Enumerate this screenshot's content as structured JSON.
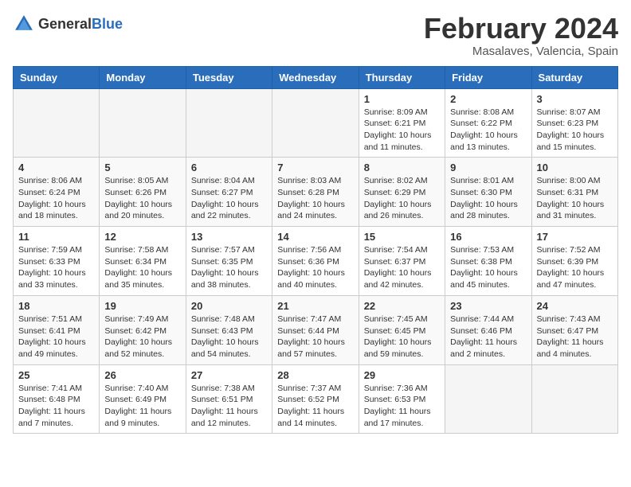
{
  "header": {
    "logo_general": "General",
    "logo_blue": "Blue",
    "month_year": "February 2024",
    "location": "Masalaves, Valencia, Spain"
  },
  "days_of_week": [
    "Sunday",
    "Monday",
    "Tuesday",
    "Wednesday",
    "Thursday",
    "Friday",
    "Saturday"
  ],
  "weeks": [
    [
      {
        "day": "",
        "info": ""
      },
      {
        "day": "",
        "info": ""
      },
      {
        "day": "",
        "info": ""
      },
      {
        "day": "",
        "info": ""
      },
      {
        "day": "1",
        "info": "Sunrise: 8:09 AM\nSunset: 6:21 PM\nDaylight: 10 hours and 11 minutes."
      },
      {
        "day": "2",
        "info": "Sunrise: 8:08 AM\nSunset: 6:22 PM\nDaylight: 10 hours and 13 minutes."
      },
      {
        "day": "3",
        "info": "Sunrise: 8:07 AM\nSunset: 6:23 PM\nDaylight: 10 hours and 15 minutes."
      }
    ],
    [
      {
        "day": "4",
        "info": "Sunrise: 8:06 AM\nSunset: 6:24 PM\nDaylight: 10 hours and 18 minutes."
      },
      {
        "day": "5",
        "info": "Sunrise: 8:05 AM\nSunset: 6:26 PM\nDaylight: 10 hours and 20 minutes."
      },
      {
        "day": "6",
        "info": "Sunrise: 8:04 AM\nSunset: 6:27 PM\nDaylight: 10 hours and 22 minutes."
      },
      {
        "day": "7",
        "info": "Sunrise: 8:03 AM\nSunset: 6:28 PM\nDaylight: 10 hours and 24 minutes."
      },
      {
        "day": "8",
        "info": "Sunrise: 8:02 AM\nSunset: 6:29 PM\nDaylight: 10 hours and 26 minutes."
      },
      {
        "day": "9",
        "info": "Sunrise: 8:01 AM\nSunset: 6:30 PM\nDaylight: 10 hours and 28 minutes."
      },
      {
        "day": "10",
        "info": "Sunrise: 8:00 AM\nSunset: 6:31 PM\nDaylight: 10 hours and 31 minutes."
      }
    ],
    [
      {
        "day": "11",
        "info": "Sunrise: 7:59 AM\nSunset: 6:33 PM\nDaylight: 10 hours and 33 minutes."
      },
      {
        "day": "12",
        "info": "Sunrise: 7:58 AM\nSunset: 6:34 PM\nDaylight: 10 hours and 35 minutes."
      },
      {
        "day": "13",
        "info": "Sunrise: 7:57 AM\nSunset: 6:35 PM\nDaylight: 10 hours and 38 minutes."
      },
      {
        "day": "14",
        "info": "Sunrise: 7:56 AM\nSunset: 6:36 PM\nDaylight: 10 hours and 40 minutes."
      },
      {
        "day": "15",
        "info": "Sunrise: 7:54 AM\nSunset: 6:37 PM\nDaylight: 10 hours and 42 minutes."
      },
      {
        "day": "16",
        "info": "Sunrise: 7:53 AM\nSunset: 6:38 PM\nDaylight: 10 hours and 45 minutes."
      },
      {
        "day": "17",
        "info": "Sunrise: 7:52 AM\nSunset: 6:39 PM\nDaylight: 10 hours and 47 minutes."
      }
    ],
    [
      {
        "day": "18",
        "info": "Sunrise: 7:51 AM\nSunset: 6:41 PM\nDaylight: 10 hours and 49 minutes."
      },
      {
        "day": "19",
        "info": "Sunrise: 7:49 AM\nSunset: 6:42 PM\nDaylight: 10 hours and 52 minutes."
      },
      {
        "day": "20",
        "info": "Sunrise: 7:48 AM\nSunset: 6:43 PM\nDaylight: 10 hours and 54 minutes."
      },
      {
        "day": "21",
        "info": "Sunrise: 7:47 AM\nSunset: 6:44 PM\nDaylight: 10 hours and 57 minutes."
      },
      {
        "day": "22",
        "info": "Sunrise: 7:45 AM\nSunset: 6:45 PM\nDaylight: 10 hours and 59 minutes."
      },
      {
        "day": "23",
        "info": "Sunrise: 7:44 AM\nSunset: 6:46 PM\nDaylight: 11 hours and 2 minutes."
      },
      {
        "day": "24",
        "info": "Sunrise: 7:43 AM\nSunset: 6:47 PM\nDaylight: 11 hours and 4 minutes."
      }
    ],
    [
      {
        "day": "25",
        "info": "Sunrise: 7:41 AM\nSunset: 6:48 PM\nDaylight: 11 hours and 7 minutes."
      },
      {
        "day": "26",
        "info": "Sunrise: 7:40 AM\nSunset: 6:49 PM\nDaylight: 11 hours and 9 minutes."
      },
      {
        "day": "27",
        "info": "Sunrise: 7:38 AM\nSunset: 6:51 PM\nDaylight: 11 hours and 12 minutes."
      },
      {
        "day": "28",
        "info": "Sunrise: 7:37 AM\nSunset: 6:52 PM\nDaylight: 11 hours and 14 minutes."
      },
      {
        "day": "29",
        "info": "Sunrise: 7:36 AM\nSunset: 6:53 PM\nDaylight: 11 hours and 17 minutes."
      },
      {
        "day": "",
        "info": ""
      },
      {
        "day": "",
        "info": ""
      }
    ]
  ]
}
